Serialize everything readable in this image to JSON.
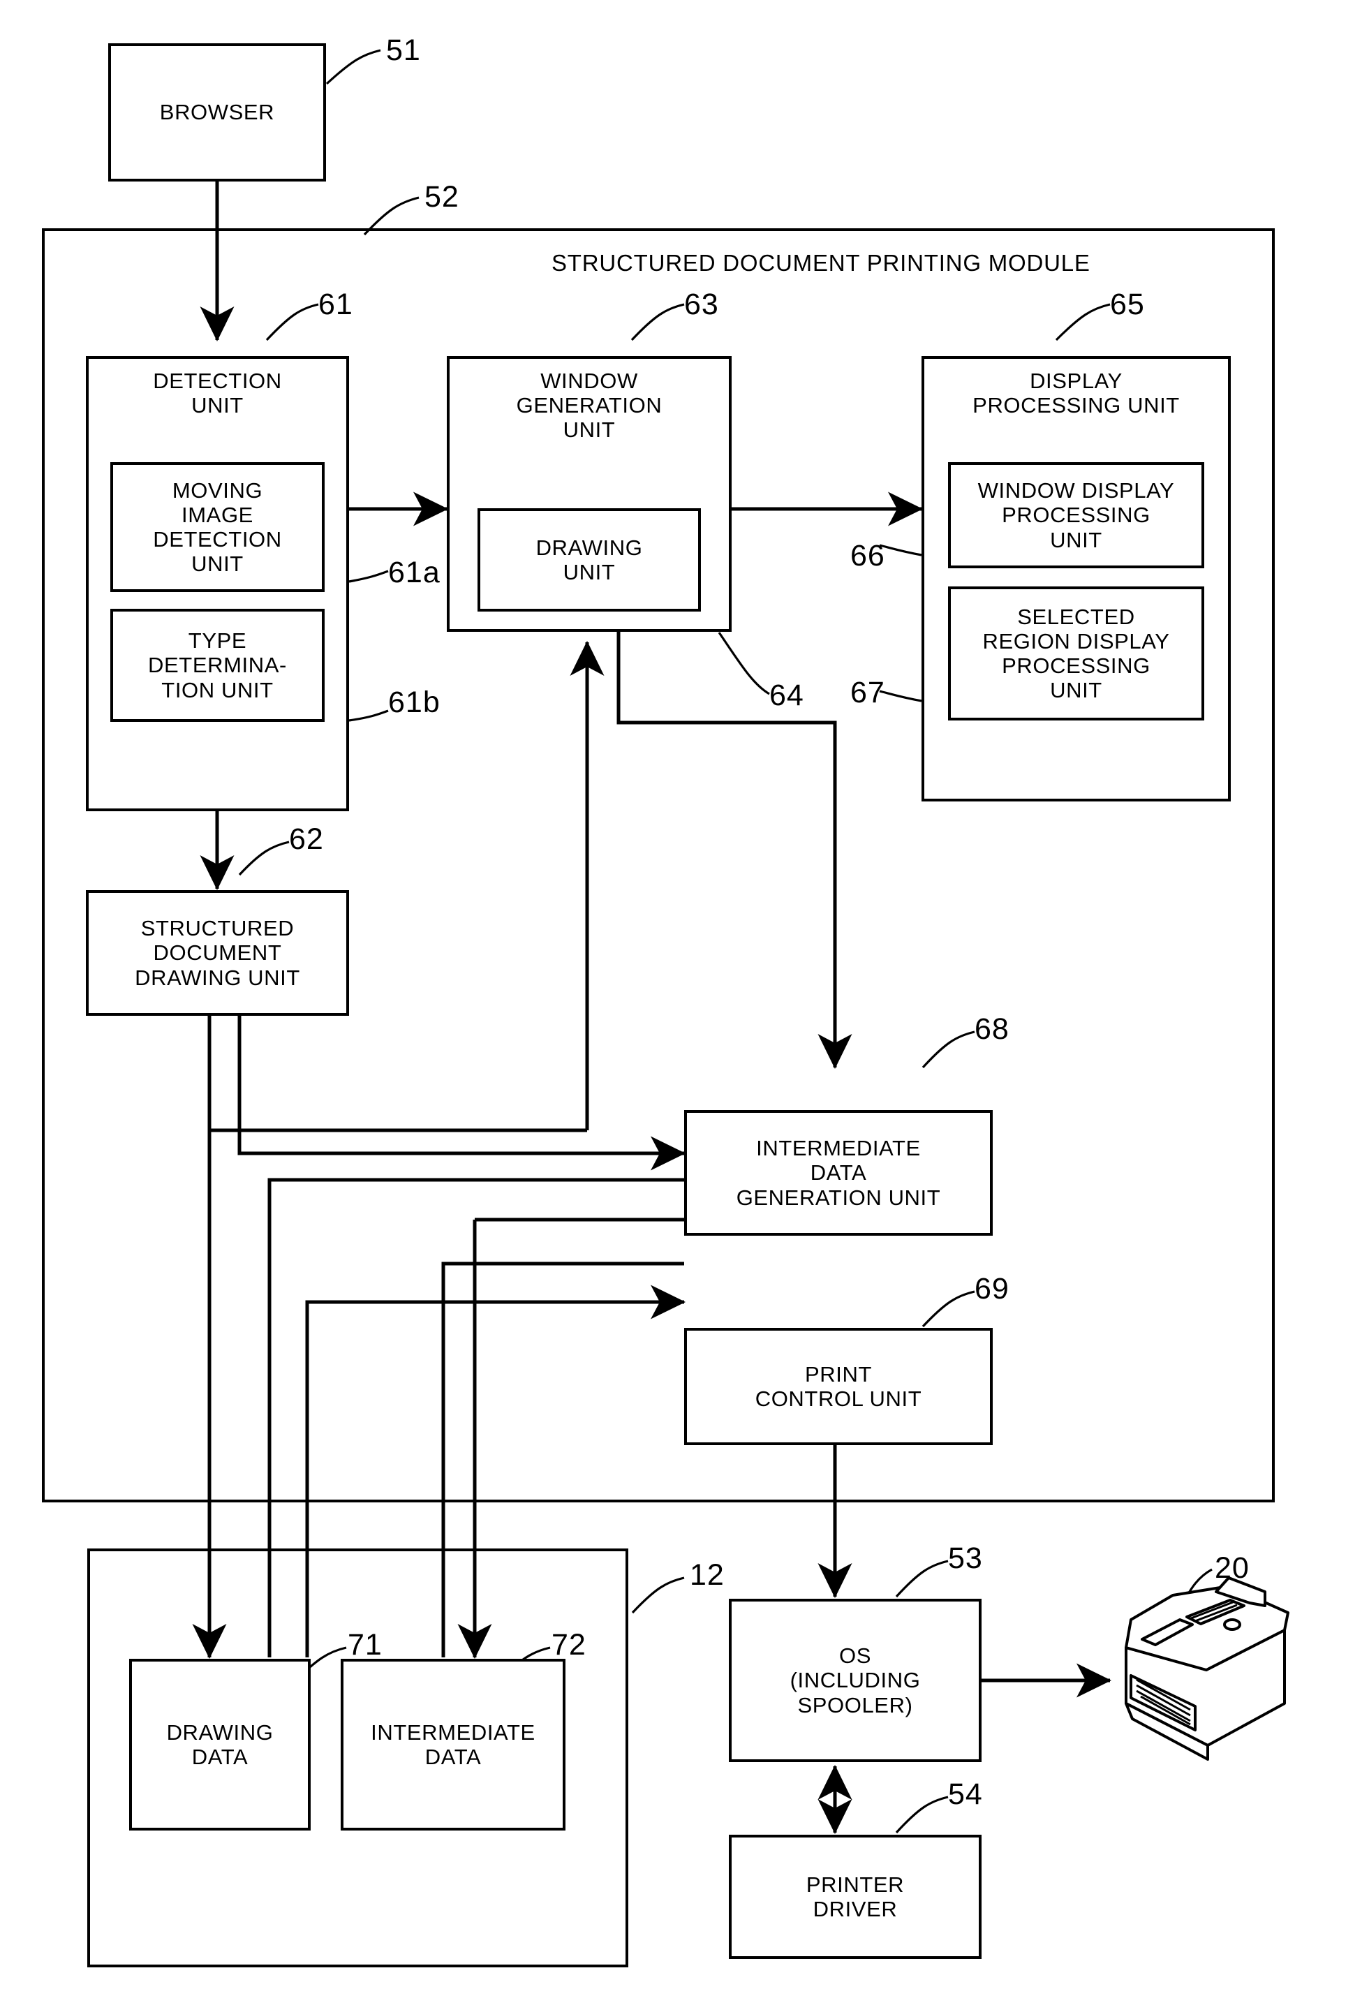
{
  "figure": {
    "type": "patent-block-diagram",
    "title": "Structured document printing module block diagram"
  },
  "blocks": {
    "browser": {
      "label": "BROWSER",
      "ref": "51"
    },
    "module": {
      "title": "STRUCTURED DOCUMENT PRINTING MODULE",
      "ref": "52"
    },
    "detection_unit": {
      "label": "DETECTION\nUNIT",
      "ref": "61"
    },
    "moving_image_detection_unit": {
      "label": "MOVING\nIMAGE\nDETECTION\nUNIT",
      "ref": "61a"
    },
    "type_determination_unit": {
      "label": "TYPE\nDETERMINA-\nTION UNIT",
      "ref": "61b"
    },
    "structured_document_drawing_unit": {
      "label": "STRUCTURED\nDOCUMENT\nDRAWING UNIT",
      "ref": "62"
    },
    "window_generation_unit": {
      "label": "WINDOW\nGENERATION\nUNIT",
      "ref": "63"
    },
    "drawing_unit": {
      "label": "DRAWING\nUNIT",
      "ref": "64"
    },
    "display_processing_unit": {
      "label": "DISPLAY\nPROCESSING UNIT",
      "ref": "65"
    },
    "window_display_processing_unit": {
      "label": "WINDOW DISPLAY\nPROCESSING\nUNIT",
      "ref": "66"
    },
    "selected_region_display_processing_unit": {
      "label": "SELECTED\nREGION DISPLAY\nPROCESSING\nUNIT",
      "ref": "67"
    },
    "intermediate_data_generation_unit": {
      "label": "INTERMEDIATE\nDATA\nGENERATION UNIT",
      "ref": "68"
    },
    "print_control_unit": {
      "label": "PRINT\nCONTROL UNIT",
      "ref": "69"
    },
    "storage_container": {
      "ref": "12"
    },
    "drawing_data": {
      "label": "DRAWING\nDATA",
      "ref": "71"
    },
    "intermediate_data": {
      "label": "INTERMEDIATE\nDATA",
      "ref": "72"
    },
    "os_spooler": {
      "label": "OS\n(INCLUDING\nSPOOLER)",
      "ref": "53"
    },
    "printer_driver": {
      "label": "PRINTER\nDRIVER",
      "ref": "54"
    },
    "printer": {
      "ref": "20",
      "icon": "printer-icon"
    }
  },
  "colors": {
    "line": "#000000",
    "background": "#ffffff"
  }
}
